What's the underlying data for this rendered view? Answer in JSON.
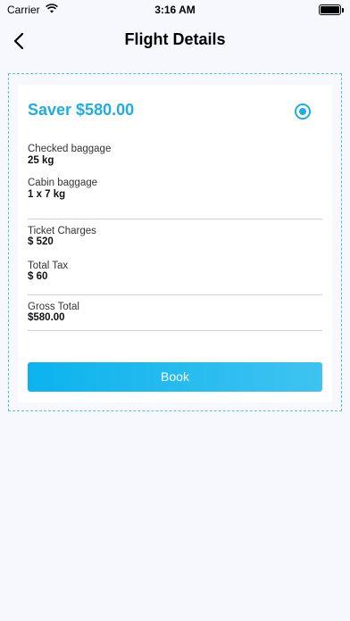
{
  "status_bar": {
    "carrier": "Carrier",
    "time": "3:16 AM"
  },
  "header": {
    "title": "Flight Details"
  },
  "fare": {
    "title": "Saver $580.00",
    "selected": true,
    "checked_baggage": {
      "label": "Checked baggage",
      "value": "25 kg"
    },
    "cabin_baggage": {
      "label": "Cabin baggage",
      "value": "1 x 7 kg"
    },
    "ticket_charges": {
      "label": "Ticket Charges",
      "value": "$ 520"
    },
    "total_tax": {
      "label": "Total Tax",
      "value": "$ 60"
    },
    "gross_total": {
      "label": "Gross Total",
      "value": "$580.00"
    }
  },
  "actions": {
    "book_label": "Book"
  },
  "colors": {
    "accent": "#1EAEE0",
    "button_start": "#0BB3EE",
    "button_end": "#3FC3F0",
    "background": "#F7F8FD",
    "card": "#FFFFFF"
  }
}
